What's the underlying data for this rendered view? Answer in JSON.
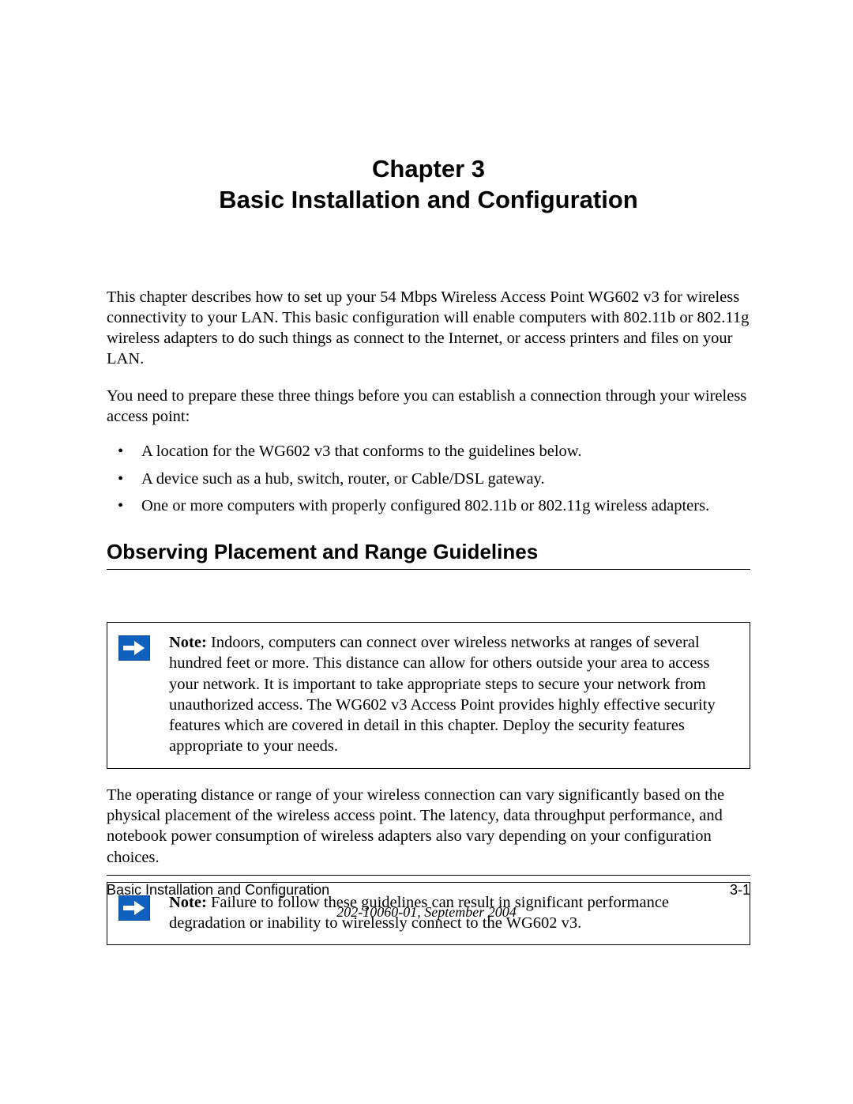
{
  "chapter": {
    "line1": "Chapter 3",
    "line2": "Basic Installation and Configuration"
  },
  "intro": {
    "p1": "This chapter describes how to set up your 54 Mbps Wireless Access Point WG602 v3 for wireless connectivity to your LAN. This basic configuration will enable computers with 802.11b or 802.11g wireless adapters to do such things as connect to the Internet, or access printers and files on your LAN.",
    "p2": "You need to prepare these three things before you can establish a connection through your wireless access point:",
    "bullets": [
      "A location for the WG602 v3 that conforms to the guidelines below.",
      "A device such as a hub, switch, router, or Cable/DSL gateway.",
      "One or more computers with properly configured 802.11b or 802.11g wireless adapters."
    ]
  },
  "section1": {
    "heading": "Observing Placement and Range Guidelines",
    "note1_label": "Note:",
    "note1_text": " Indoors, computers can connect over wireless networks at ranges of several hundred feet or more. This distance can allow for others outside your area to access your network. It is important to take appropriate steps to secure your network from unauthorized access. The WG602 v3 Access Point provides highly effective security features which are covered in detail in this chapter. Deploy the security features appropriate to your needs.",
    "p1": "The operating distance or range of your wireless connection can vary significantly based on the physical placement of the wireless access point. The latency, data throughput performance, and notebook power consumption of wireless adapters also vary depending on your configuration choices.",
    "note2_label": "Note:",
    "note2_text": " Failure to follow these guidelines can result in significant performance degradation or inability to wirelessly connect to the WG602 v3."
  },
  "footer": {
    "left": "Basic Installation and Configuration",
    "right": "3-1",
    "docref": "202-10060-01, September 2004"
  }
}
